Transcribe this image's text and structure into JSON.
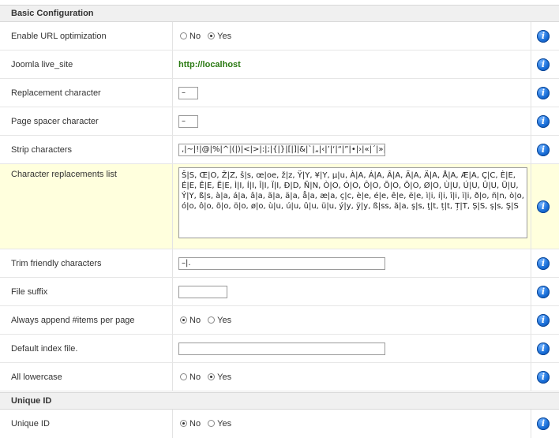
{
  "sections": {
    "basic": "Basic Configuration",
    "unique": "Unique ID"
  },
  "options": {
    "no": "No",
    "yes": "Yes"
  },
  "rows": {
    "url_opt": {
      "label": "Enable URL optimization",
      "selected": "yes"
    },
    "live_site": {
      "label": "Joomla live_site",
      "value": "http://localhost"
    },
    "replacement": {
      "label": "Replacement character",
      "value": "–"
    },
    "spacer": {
      "label": "Page spacer character",
      "value": "–"
    },
    "strip": {
      "label": "Strip characters",
      "value": ",|~|!|@|%|^|(|)|<|>|:|;|{|}|[|]|&|`|„|‹|’|‘|“|”|•|›|«|´|»|°"
    },
    "replacements": {
      "label": "Character replacements list",
      "value": "Š|S, Œ|O, Ž|Z, š|s, œ|oe, ž|z, Ÿ|Y, ¥|Y, µ|u, À|A, Á|A, Â|A, Ã|A, Ä|A, Å|A, Æ|A, Ç|C, È|E, É|E, Ê|E, Ë|E, Ì|I, Í|I, Î|I, Ï|I, Ð|D, Ñ|N, Ò|O, Ó|O, Ô|O, Õ|O, Ö|O, Ø|O, Ù|U, Ú|U, Û|U, Ü|U, Ý|Y, ß|s, à|a, á|a, â|a, ã|a, ä|a, å|a, æ|a, ç|c, è|e, é|e, ê|e, ë|e, ì|i, í|i, î|i, ï|i, ð|o, ñ|n, ò|o, ó|o, ô|o, õ|o, ö|o, ø|o, ù|u, ú|u, û|u, ü|u, ý|y, ÿ|y, ß|ss, ă|a, ş|s, ţ|t, ț|t, Ț|T, Ș|S, ș|s, Ş|S"
    },
    "trim": {
      "label": "Trim friendly characters",
      "value": "–|."
    },
    "suffix": {
      "label": "File suffix",
      "value": ""
    },
    "append_items": {
      "label": "Always append #items per page",
      "selected": "no"
    },
    "index_file": {
      "label": "Default index file.",
      "value": ""
    },
    "lowercase": {
      "label": "All lowercase",
      "selected": "yes"
    },
    "unique_id": {
      "label": "Unique ID",
      "selected": "no"
    }
  }
}
